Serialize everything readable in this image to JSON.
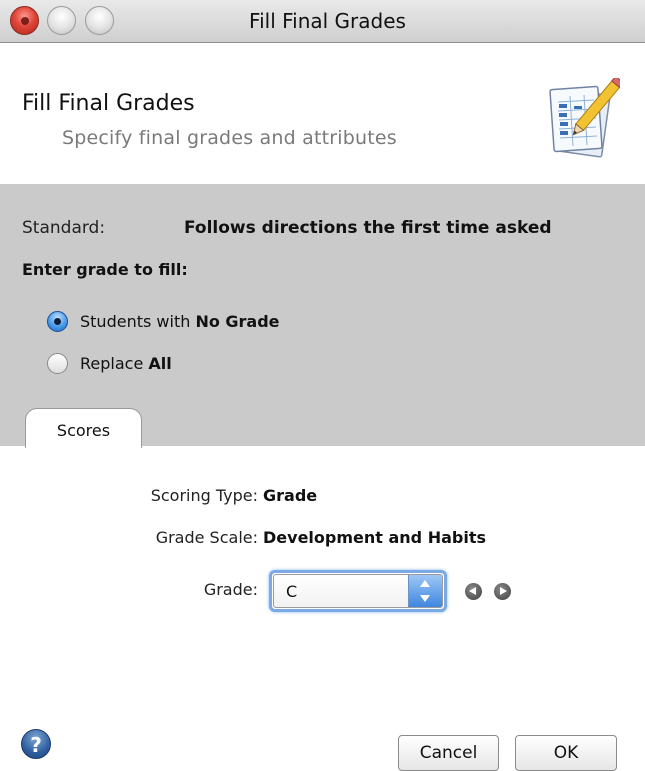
{
  "window": {
    "title": "Fill Final Grades"
  },
  "header": {
    "title": "Fill Final Grades",
    "subtitle": "Specify final grades and attributes",
    "icon": "gradebook-pencil-icon"
  },
  "panel": {
    "standard_label": "Standard:",
    "standard_value": "Follows directions the first time asked",
    "enter_label": "Enter grade to fill:",
    "options": [
      {
        "prefix": "Students with ",
        "bold": "No Grade",
        "selected": true
      },
      {
        "prefix": "Replace ",
        "bold": "All",
        "selected": false
      }
    ]
  },
  "tabs": [
    {
      "label": "Scores",
      "selected": true
    }
  ],
  "scores": {
    "scoring_type_label": "Scoring Type:",
    "scoring_type_value": "Grade",
    "grade_scale_label": "Grade Scale:",
    "grade_scale_value": "Development and Habits",
    "grade_label": "Grade:",
    "grade_value": "C"
  },
  "footer": {
    "help_icon": "help-icon",
    "help_glyph": "?",
    "cancel_label": "Cancel",
    "ok_label": "OK"
  },
  "colors": {
    "panel_bg": "#cacaca",
    "focus_ring": "#7aa9e4",
    "close_red": "#e0463a"
  }
}
